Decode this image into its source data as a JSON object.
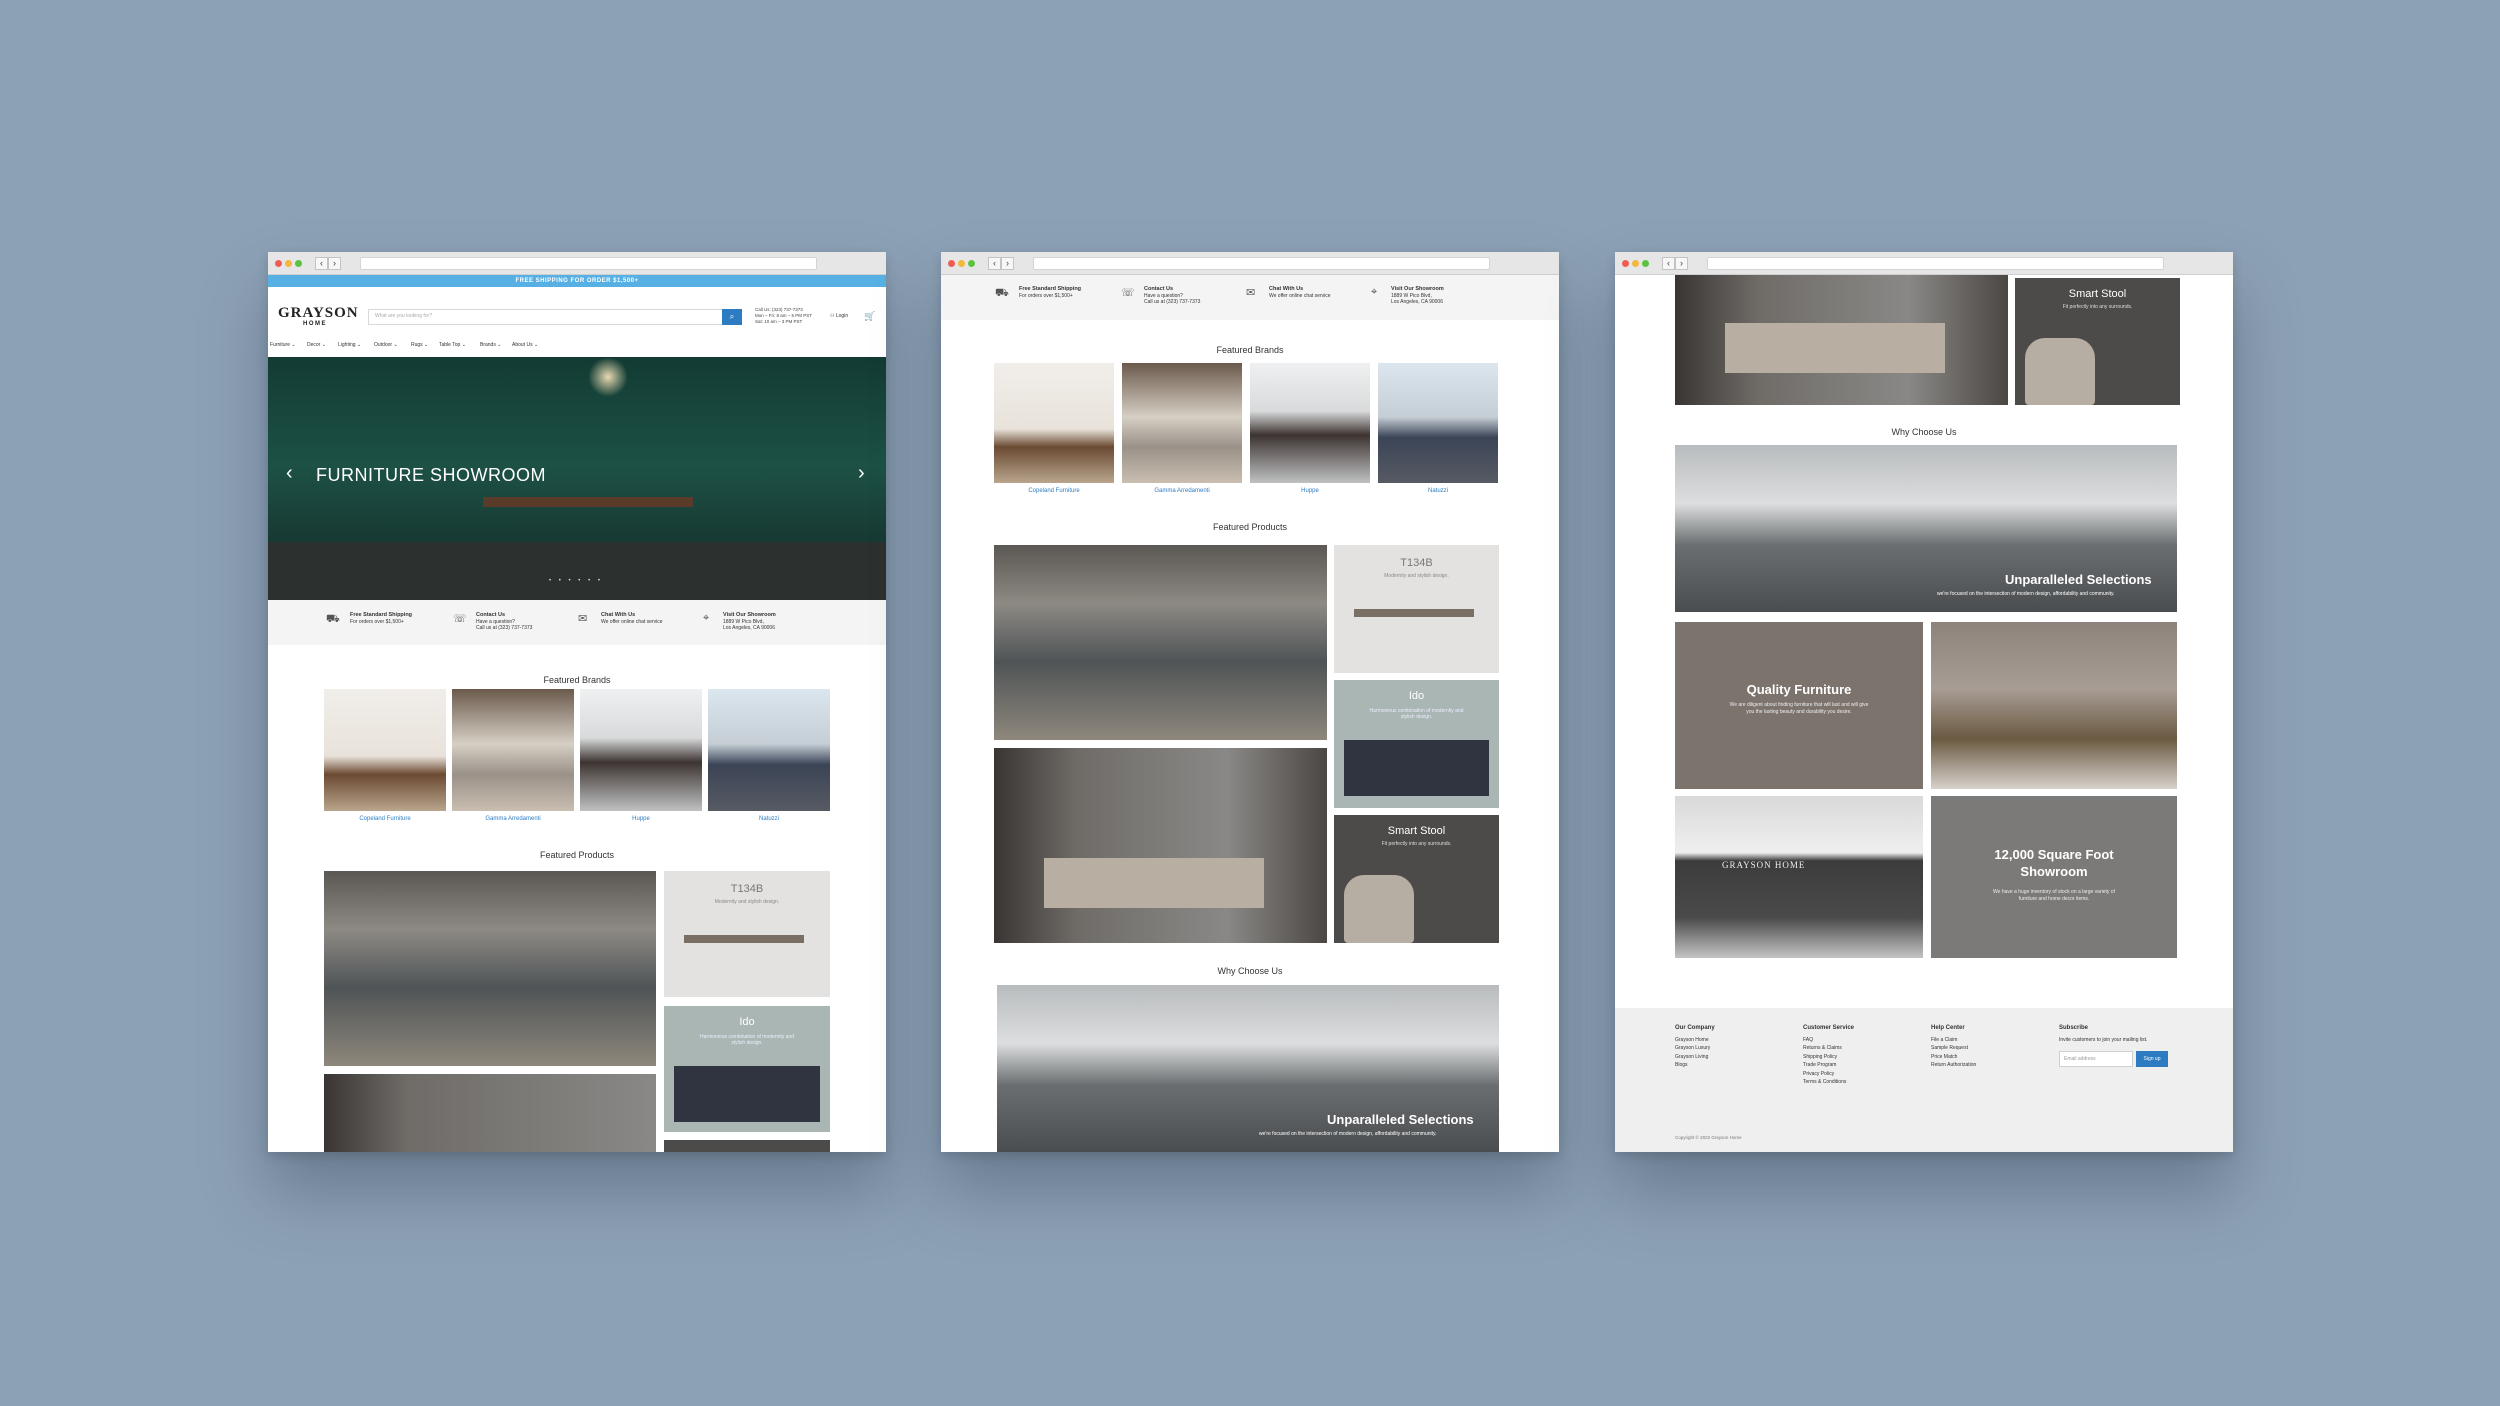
{
  "colors": {
    "background": "#8da1b6",
    "accent": "#2d7cc1",
    "announcement": "#56b0e4",
    "link": "#2e7cc4"
  },
  "announcement": "FREE SHIPPING FOR ORDER $1,500+",
  "header": {
    "logo": "GRAYSON",
    "logo_sub": "HOME",
    "search_placeholder": "What are you looking for?",
    "hours": [
      "Call Us: (323) 737-7373",
      "Mon – Fri: 8 am – 5 PM PST",
      "Sat: 10 am – 3 PM PST"
    ],
    "login": "Login",
    "menu": [
      "Furniture ⌄",
      "Decor ⌄",
      "Lighting ⌄",
      "Outdoor ⌄",
      "Rugs ⌄",
      "Table Top ⌄",
      "Brands ⌄",
      "About Us ⌄"
    ]
  },
  "hero": {
    "title": "FURNITURE SHOWROOM",
    "dots": "• • • • • •"
  },
  "info_items": [
    {
      "icon": "truck-icon",
      "title": "Free Standard Shipping",
      "line1": "For orders over $1,500+",
      "line2": ""
    },
    {
      "icon": "phone-icon",
      "title": "Contact Us",
      "line1": "Have a question?",
      "line2": "Call us at (323) 737-7373"
    },
    {
      "icon": "chat-icon",
      "title": "Chat With Us",
      "line1": "We offer online chat service",
      "line2": ""
    },
    {
      "icon": "location-icon",
      "title": "Visit Our Showroom",
      "line1": "1889 W Pico Blvd,",
      "line2": "Los Angeles, CA 90006"
    }
  ],
  "featured_brands_title": "Featured Brands",
  "brands": [
    "Copeland Furniture",
    "Gamma Arredamenti",
    "Huppe",
    "Natuzzi"
  ],
  "featured_products_title": "Featured Products",
  "products": [
    {
      "title": "T134B",
      "subtitle": "Modernity and stylish design."
    },
    {
      "title": "Ido",
      "subtitle": "Harmonious combination of modernity and stylish design."
    },
    {
      "title": "Smart Stool",
      "subtitle": "Fit perfectly into any surrounds."
    }
  ],
  "why_title": "Why Choose Us",
  "why_tiles": [
    {
      "title": "Unparalleled Selections",
      "subtitle": "we're focused on the intersection of modern design, affordability and community."
    },
    {
      "title": "Quality Furniture",
      "subtitle": "We are diligent about finding furniture that will last and will give you the lasting beauty and durability you desire."
    },
    {
      "title": "12,000 Square Foot Showroom",
      "subtitle": "We have a huge inventory of stock on a large variety of furniture and home decor items."
    },
    {
      "sign": "GRAYSON HOME"
    }
  ],
  "footer": {
    "columns": [
      {
        "title": "Our Company",
        "links": [
          "Grayson Home",
          "Grayson Luxury",
          "Grayson Living",
          "Blogs"
        ]
      },
      {
        "title": "Customer Service",
        "links": [
          "FAQ",
          "Returns & Claims",
          "Shipping Policy",
          "Trade Program",
          "Privacy Policy",
          "Terms & Conditions"
        ]
      },
      {
        "title": "Help Center",
        "links": [
          "File a Claim",
          "Sample Request",
          "Price Match",
          "Return Authorization"
        ]
      }
    ],
    "subscribe_title": "Subscribe",
    "subscribe_text": "Invite customers to join your mailing list.",
    "email_placeholder": "Email address",
    "signup_label": "Sign up",
    "copyright": "Copyright © 2022 Grayson Home"
  }
}
